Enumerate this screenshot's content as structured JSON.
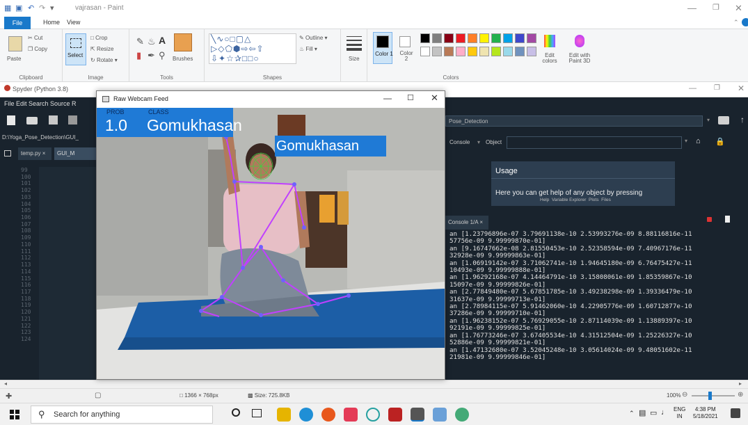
{
  "paint": {
    "title": "vajrasan - Paint",
    "tabs": {
      "file": "File",
      "home": "Home",
      "view": "View"
    },
    "clipboard": {
      "paste": "Paste",
      "cut": "Cut",
      "copy": "Copy",
      "label": "Clipboard"
    },
    "image": {
      "select": "Select",
      "crop": "Crop",
      "resize": "Resize",
      "rotate": "Rotate",
      "label": "Image"
    },
    "tools": {
      "label": "Tools",
      "brushes": "Brushes"
    },
    "shapes": {
      "label": "Shapes",
      "outline": "Outline",
      "fill": "Fill"
    },
    "size_label": "Size",
    "color1": "Color 1",
    "color2": "Color 2",
    "colors_label": "Colors",
    "edit_colors": "Edit colors",
    "edit_paint3d": "Edit with Paint 3D",
    "palette": [
      "#000000",
      "#7f7f7f",
      "#880015",
      "#ed1c24",
      "#ff7f27",
      "#fff200",
      "#22b14c",
      "#00a2e8",
      "#3f48cc",
      "#a349a4",
      "#ffffff",
      "#c3c3c3",
      "#b97a57",
      "#ffaec9",
      "#ffc90e",
      "#efe4b0",
      "#b5e61d",
      "#99d9ea",
      "#7092be",
      "#c8bfe7"
    ],
    "status": {
      "dimensions": "1366 × 768px",
      "size": "Size: 725.8KB",
      "zoom": "100%"
    }
  },
  "spyder": {
    "title": "Spyder (Python 3.8)",
    "menu": "File  Edit  Search  Source  R",
    "path": "D:\\Yoga_Pose_Detection\\GUI_",
    "editor_tabs": [
      "temp.py",
      "GUI_M"
    ],
    "line_numbers": [
      "99",
      "100",
      "101",
      "102",
      "103",
      "104",
      "105",
      "106",
      "107",
      "108",
      "109",
      "110",
      "111",
      "112",
      "113",
      "114",
      "115",
      "116",
      "117",
      "118",
      "119",
      "120",
      "121",
      "122",
      "123",
      "124"
    ],
    "pane_path": "Pose_Detection",
    "help_tabs": {
      "console": "Console",
      "object": "Object"
    },
    "usage_title": "Usage",
    "usage_text": "Here you can get help of any object by pressing",
    "help_bottom_tabs": [
      "Help",
      "Variable Explorer",
      "Plots",
      "Files"
    ],
    "console_tab": "Console 1/A",
    "console_lines": [
      "an [1.23796896e-07 3.79691138e-10 2.53993276e-09 8.88116816e-11",
      "57756e-09 9.99999870e-01]",
      "an [9.16747662e-08 2.81550453e-10 2.52358594e-09 7.40967176e-11",
      "32928e-09 9.99999863e-01]",
      "an [1.06919142e-07 3.71062741e-10 1.94645180e-09 6.76475427e-11",
      "10493e-09 9.99999888e-01]",
      "an [1.96292168e-07 4.14464791e-10 3.15808061e-09 1.85359867e-10",
      "15097e-09 9.99999826e-01]",
      "an [2.77849480e-07 5.67851785e-10 3.49238298e-09 1.39336479e-10",
      "31637e-09 9.99999713e-01]",
      "an [2.78984115e-07 5.91462060e-10 4.22905776e-09 1.60712877e-10",
      "37286e-09 9.99999710e-01]",
      "an [1.96238152e-07 5.76929055e-10 2.87114039e-09 1.13889397e-10",
      "92191e-09 9.99999825e-01]",
      "an [1.76773246e-07 3.67405534e-10 4.31512504e-09 1.25226327e-10",
      "52886e-09 9.99999821e-01]",
      "an [1.47132680e-07 3.52045248e-10 3.05614024e-09 9.48051602e-11",
      "21981e-09 9.99999846e-01]"
    ]
  },
  "webcam": {
    "title": "Raw Webcam Feed",
    "prob_label": "PROB",
    "class_label": "CLASS",
    "prob_value": "1.0",
    "class_value": "Gomukhasan",
    "pose_label": "Gomukhasan"
  },
  "taskbar": {
    "search_placeholder": "Search for anything",
    "lang": "ENG",
    "region": "IN",
    "time": "4:38 PM",
    "date": "5/18/2021"
  }
}
